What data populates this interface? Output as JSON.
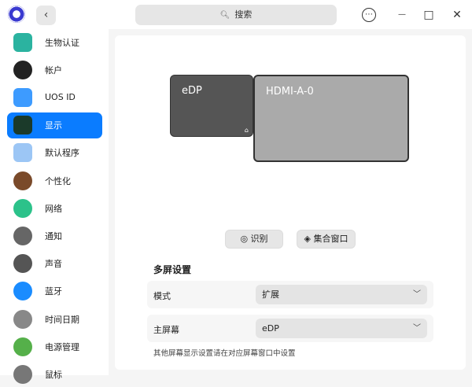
{
  "titlebar": {
    "search_placeholder": "搜索",
    "back": "‹",
    "menu": "⋯",
    "minimize": "—",
    "maximize": "□",
    "close": "✕"
  },
  "sidebar": {
    "items": [
      {
        "label": "生物认证",
        "color": "#2bb3a0"
      },
      {
        "label": "帐户",
        "color": "#222222"
      },
      {
        "label": "UOS ID",
        "color": "#3d9bff"
      },
      {
        "label": "显示",
        "color": "#1b3a2a"
      },
      {
        "label": "默认程序",
        "color": "#9cc6f5"
      },
      {
        "label": "个性化",
        "color": "#7a4a2a"
      },
      {
        "label": "网络",
        "color": "#2cc28a"
      },
      {
        "label": "通知",
        "color": "#666666"
      },
      {
        "label": "声音",
        "color": "#555555"
      },
      {
        "label": "蓝牙",
        "color": "#1a8cff"
      },
      {
        "label": "时间日期",
        "color": "#888888"
      },
      {
        "label": "电源管理",
        "color": "#55b04a"
      },
      {
        "label": "鼠标",
        "color": "#777777"
      }
    ],
    "active": 3
  },
  "monitors": {
    "primary": "eDP",
    "secondary": "HDMI-A-0"
  },
  "buttons": {
    "identify": "识别",
    "gather": "集合窗口"
  },
  "multi": {
    "title": "多屏设置",
    "mode_label": "模式",
    "mode_value": "扩展",
    "primary_label": "主屏幕",
    "primary_value": "eDP",
    "note": "其他屏幕显示设置请在对应屏幕窗口中设置"
  }
}
